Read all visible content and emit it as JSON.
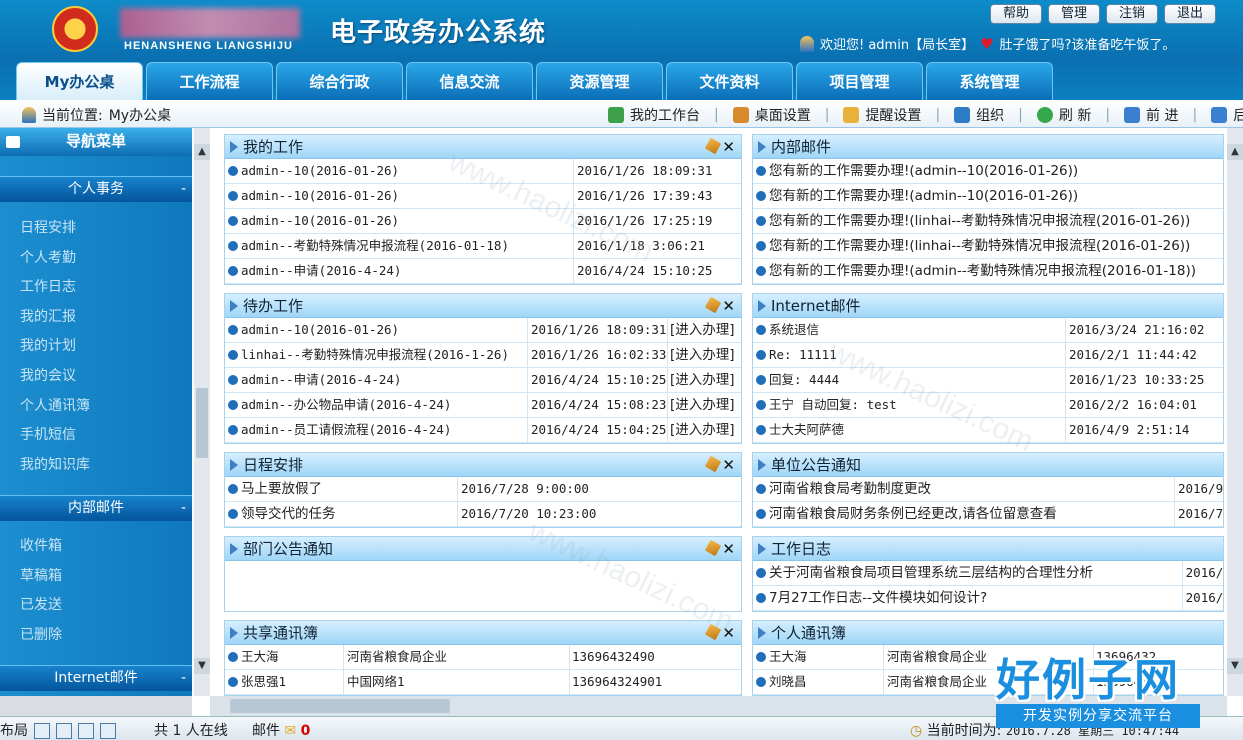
{
  "header": {
    "org_pinyin": "HENANSHENG  LIANGSHIJU",
    "system_title": "电子政务办公系统",
    "top_buttons": [
      "帮助",
      "管理",
      "注销",
      "退出"
    ],
    "welcome": "欢迎您! admin【局长室】",
    "greeting": "肚子饿了吗?该准备吃午饭了。"
  },
  "tabs": [
    "My办公桌",
    "工作流程",
    "综合行政",
    "信息交流",
    "资源管理",
    "文件资料",
    "项目管理",
    "系统管理"
  ],
  "location": {
    "label": "当前位置:",
    "value": "My办公桌"
  },
  "toolbar": [
    "我的工作台",
    "桌面设置",
    "提醒设置",
    "组织",
    "刷 新",
    "前 进",
    "后 退"
  ],
  "sidebar": {
    "title": "导航菜单",
    "sections": [
      {
        "title": "个人事务",
        "items": [
          "日程安排",
          "个人考勤",
          "工作日志",
          "我的汇报",
          "我的计划",
          "我的会议",
          "个人通讯簿",
          "手机短信",
          "我的知识库"
        ]
      },
      {
        "title": "内部邮件",
        "items": [
          "收件箱",
          "草稿箱",
          "已发送",
          "已删除"
        ]
      },
      {
        "title": "Internet邮件",
        "items": []
      }
    ]
  },
  "panels": {
    "my_work": {
      "title": "我的工作",
      "rows": [
        [
          "admin--10(2016-01-26)",
          "2016/1/26 18:09:31"
        ],
        [
          "admin--10(2016-01-26)",
          "2016/1/26 17:39:43"
        ],
        [
          "admin--10(2016-01-26)",
          "2016/1/26 17:25:19"
        ],
        [
          "admin--考勤特殊情况申报流程(2016-01-18)",
          "2016/1/18 3:06:21"
        ],
        [
          "admin--申请(2016-4-24)",
          "2016/4/24 15:10:25"
        ]
      ]
    },
    "internal_mail": {
      "title": "内部邮件",
      "rows": [
        "您有新的工作需要办理!(admin--10(2016-01-26))",
        "您有新的工作需要办理!(admin--10(2016-01-26))",
        "您有新的工作需要办理!(linhai--考勤特殊情况申报流程(2016-01-26))",
        "您有新的工作需要办理!(linhai--考勤特殊情况申报流程(2016-01-26))",
        "您有新的工作需要办理!(admin--考勤特殊情况申报流程(2016-01-18))"
      ]
    },
    "todo": {
      "title": "待办工作",
      "rows": [
        [
          "admin--10(2016-01-26)",
          "2016/1/26 18:09:31",
          "[进入办理]"
        ],
        [
          "linhai--考勤特殊情况申报流程(2016-1-26)",
          "2016/1/26 16:02:33",
          "[进入办理]"
        ],
        [
          "admin--申请(2016-4-24)",
          "2016/4/24 15:10:25",
          "[进入办理]"
        ],
        [
          "admin--办公物品申请(2016-4-24)",
          "2016/4/24 15:08:23",
          "[进入办理]"
        ],
        [
          "admin--员工请假流程(2016-4-24)",
          "2016/4/24 15:04:25",
          "[进入办理]"
        ]
      ]
    },
    "internet_mail": {
      "title": "Internet邮件",
      "rows": [
        [
          "系统退信",
          "2016/3/24 21:16:02"
        ],
        [
          "Re: 11111",
          "2016/2/1 11:44:42"
        ],
        [
          "回复: 4444",
          "2016/1/23 10:33:25"
        ],
        [
          "王宁 自动回复: test",
          "2016/2/2 16:04:01"
        ],
        [
          "士大夫阿萨德",
          "2016/4/9 2:51:14"
        ]
      ]
    },
    "schedule": {
      "title": "日程安排",
      "rows": [
        [
          "马上要放假了",
          "2016/7/28 9:00:00"
        ],
        [
          "领导交代的任务",
          "2016/7/20 10:23:00"
        ]
      ]
    },
    "notice": {
      "title": "单位公告通知",
      "rows": [
        [
          "河南省粮食局考勤制度更改",
          "2016/9"
        ],
        [
          "河南省粮食局财务条例已经更改,请各位留意查看",
          "2016/7"
        ]
      ]
    },
    "dept_notice": {
      "title": "部门公告通知",
      "rows": []
    },
    "worklog": {
      "title": "工作日志",
      "rows": [
        [
          "关于河南省粮食局项目管理系统三层结构的合理性分析",
          "2016/"
        ],
        [
          "7月27工作日志--文件模块如何设计?",
          "2016/"
        ]
      ]
    },
    "shared_contacts": {
      "title": "共享通讯簿",
      "rows": [
        [
          "王大海",
          "河南省粮食局企业",
          "13696432490"
        ],
        [
          "张思强1",
          "中国网络1",
          "136964324901"
        ]
      ]
    },
    "personal_contacts": {
      "title": "个人通讯簿",
      "rows": [
        [
          "王大海",
          "河南省粮食局企业",
          "13696432"
        ],
        [
          "刘晓昌",
          "河南省粮食局企业",
          "13696432"
        ]
      ]
    }
  },
  "statusbar": {
    "layout": "布局",
    "online": "共 1 人在线",
    "mail": "邮件",
    "mail_count": "0",
    "time_label": "当前时间为:",
    "time_value": "2016.7.28 星期三 10:47:44"
  },
  "logo": {
    "big": "好例子网",
    "small": "开发实例分享交流平台"
  },
  "watermark": "www.haolizi.com",
  "colors": {
    "header_blue": "#0a6fb0",
    "tab_blue": "#1a8fd8",
    "panel_head": "#bfe4fb",
    "logo_blue": "#1a8fe0"
  }
}
